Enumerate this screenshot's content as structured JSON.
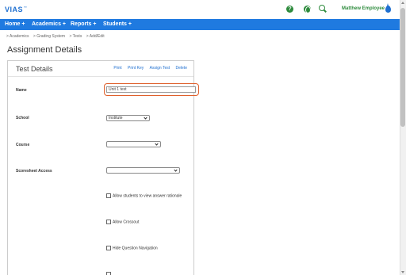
{
  "app": {
    "logo": "VIAS",
    "trademark": "™"
  },
  "header": {
    "icons": [
      "help-icon",
      "globe-icon",
      "search-icon",
      "drop-icon"
    ],
    "help_glyph": "?",
    "user_name": "Matthew Employee",
    "brand_green": "#2e8b3d",
    "brand_blue": "#1f7ae0"
  },
  "nav": {
    "items": [
      "Home +",
      "Academics +",
      "Reports +",
      "Students +"
    ]
  },
  "breadcrumb": [
    "> Academics",
    "> Grading System",
    "> Tests",
    "> Add/Edit"
  ],
  "page": {
    "title": "Assignment Details"
  },
  "panel": {
    "title": "Test Details",
    "actions": [
      "Print",
      "Print Key",
      "Assign Test",
      "Delete"
    ],
    "fields": {
      "name_label": "Name",
      "name_value": "Unit 1 test",
      "school_label": "School",
      "school_value": "Institute",
      "course_label": "Course",
      "course_value": "",
      "scoresheet_label": "Scoresheet Access",
      "scoresheet_value": ""
    },
    "checkboxes": [
      {
        "label": "Allow students to view answer rationale",
        "checked": false
      },
      {
        "label": "Allow Crossout",
        "checked": false
      },
      {
        "label": "Hide Question Navigation",
        "checked": false
      }
    ]
  }
}
